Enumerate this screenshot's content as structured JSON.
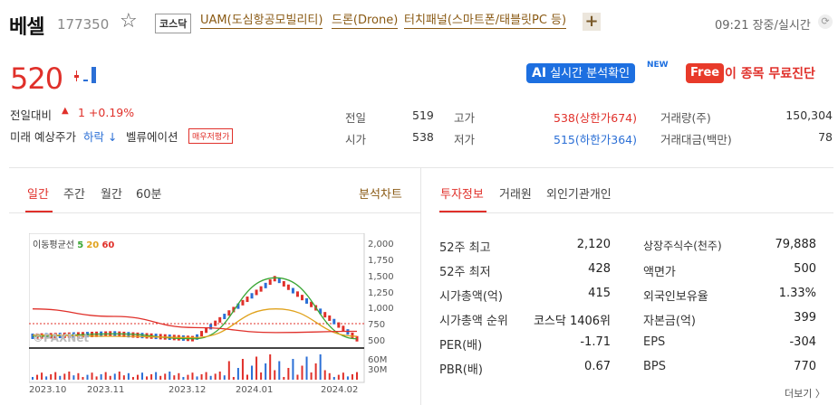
{
  "stock": {
    "name": "베셀",
    "code": "177350",
    "market": "코스닥",
    "tags": [
      "UAM(도심항공모빌리티)",
      "드론(Drone)",
      "터치패널(스마트폰/태블릿PC 등)"
    ],
    "add_label": "+",
    "time": "09:21 장중/실시간"
  },
  "price": {
    "current": "520",
    "change_label": "전일대비",
    "change_arrow": "▲",
    "change": "1 +0.19%",
    "forecast_label": "미래 예상주가",
    "forecast_value": "하락 ↓",
    "valuation_label": "벨류에이션",
    "valuation_badge": "매우저평가"
  },
  "banners": {
    "ai_prefix": "AI",
    "ai_text": "실시간 분석확인",
    "new_badge": "NEW",
    "free_label": "Free",
    "free_text": "이 종목 무료진단"
  },
  "summary": {
    "prev_label": "전일",
    "prev": "519",
    "open_label": "시가",
    "open": "538",
    "high_label": "고가",
    "high": "538(상한가674)",
    "low_label": "저가",
    "low": "515(하한가364)",
    "volume_label": "거래량(주)",
    "volume": "150,304",
    "amount_label": "거래대금(백만)",
    "amount": "78"
  },
  "chart_tabs": [
    "일간",
    "주간",
    "월간",
    "60분"
  ],
  "chart_link": "분석차트",
  "info_tabs": [
    "투자정보",
    "거래원",
    "외인기관개인"
  ],
  "chart": {
    "ma_label": "이동평균선",
    "ma_periods": [
      "5",
      "20",
      "60"
    ],
    "ma_colors": [
      "#3aa634",
      "#e0a21c",
      "#e0302a"
    ],
    "watermark": "©PAXNet",
    "price_ticks": [
      "2,000",
      "1,750",
      "1,500",
      "1,250",
      "1,000",
      "750",
      "500"
    ],
    "volume_ticks": [
      "60M",
      "30M"
    ],
    "x_ticks": [
      "2023.10",
      "2023.11",
      "2023.12",
      "2024.01",
      "2024.02"
    ]
  },
  "chart_data": {
    "type": "line",
    "title": "",
    "ylim": [
      400,
      2100
    ],
    "x": [
      "2023.10",
      "2023.11",
      "2023.12",
      "2024.01",
      "2024.02"
    ],
    "series": [
      {
        "name": "5",
        "values": [
          560,
          600,
          520,
          1500,
          520
        ]
      },
      {
        "name": "20",
        "values": [
          580,
          560,
          540,
          1000,
          560
        ]
      },
      {
        "name": "60",
        "values": [
          1000,
          880,
          700,
          620,
          640
        ]
      }
    ]
  },
  "invest": {
    "left": [
      {
        "label": "52주 최고",
        "value": "2,120"
      },
      {
        "label": "52주 최저",
        "value": "428"
      },
      {
        "label": "시가총액(억)",
        "value": "415"
      },
      {
        "label": "시가총액 순위",
        "value": "코스닥 1406위"
      },
      {
        "label": "PER(배)",
        "value": "-1.71"
      },
      {
        "label": "PBR(배)",
        "value": "0.67"
      }
    ],
    "right": [
      {
        "label": "상장주식수(천주)",
        "value": "79,888"
      },
      {
        "label": "액면가",
        "value": "500"
      },
      {
        "label": "외국인보유율",
        "value": "1.33%"
      },
      {
        "label": "자본금(억)",
        "value": "399"
      },
      {
        "label": "EPS",
        "value": "-304"
      },
      {
        "label": "BPS",
        "value": "770"
      }
    ],
    "more": "더보기 〉"
  }
}
